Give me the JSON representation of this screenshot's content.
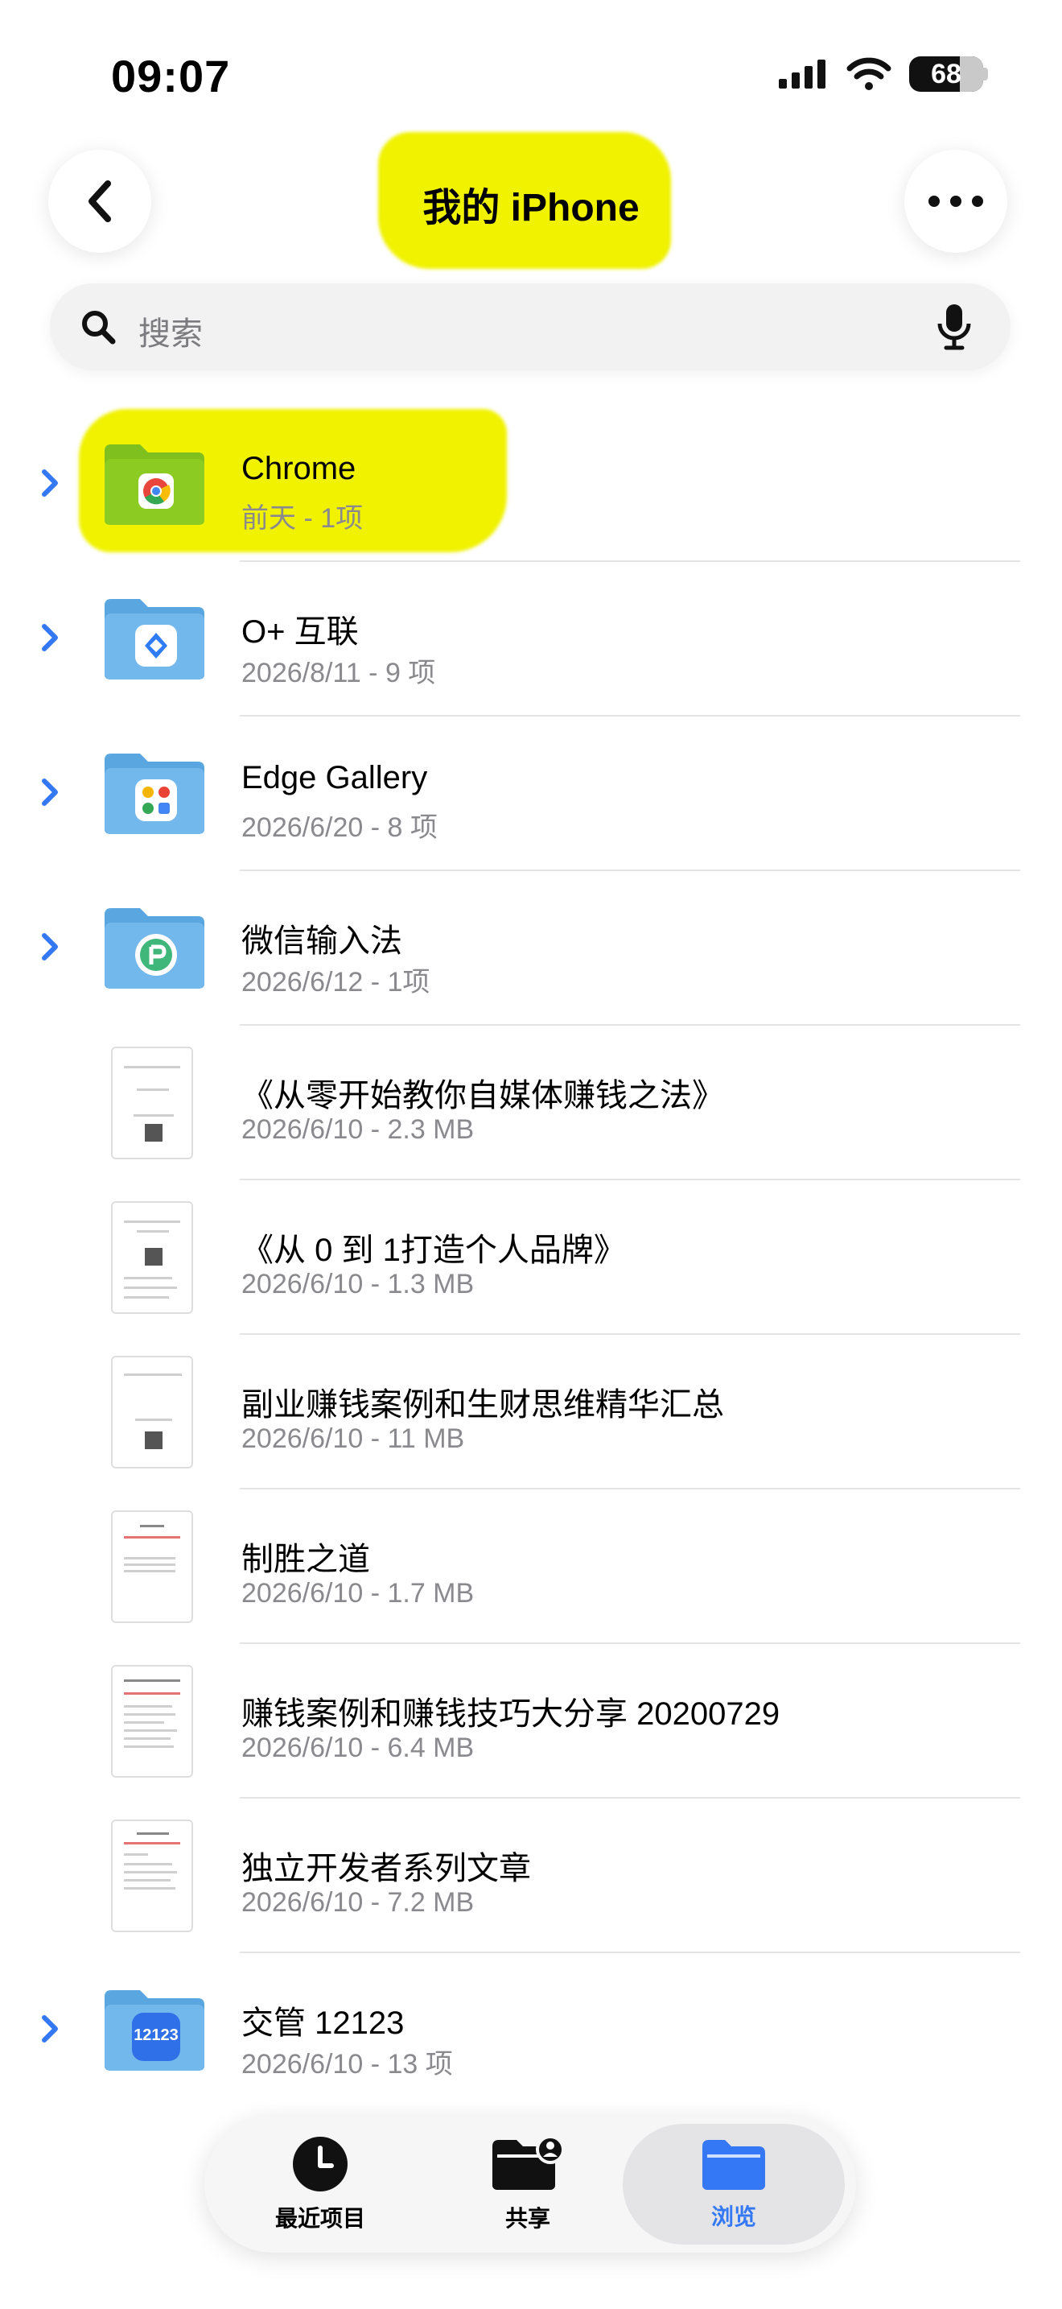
{
  "status": {
    "time": "09:07",
    "battery": "68",
    "battery_fraction": 0.68
  },
  "nav": {
    "title": "我的 iPhone",
    "back_icon": "chevron-left-icon",
    "more_icon": "ellipsis-icon"
  },
  "search": {
    "placeholder": "搜索"
  },
  "items": [
    {
      "name": "Chrome",
      "meta": "前天 - 1项",
      "type": "folder",
      "app": "chrome",
      "highlight": true
    },
    {
      "name": "O+ 互联",
      "meta": "2026/8/11 - 9 项",
      "type": "folder",
      "app": "oplus"
    },
    {
      "name": "Edge Gallery",
      "meta": "2026/6/20 - 8 项",
      "type": "folder",
      "app": "edge-gallery"
    },
    {
      "name": "微信输入法",
      "meta": "2026/6/12 - 1项",
      "type": "folder",
      "app": "wechat-input"
    },
    {
      "name": "《从零开始教你自媒体赚钱之法》",
      "meta": "2026/6/10 - 2.3 MB",
      "type": "document"
    },
    {
      "name": "《从 0 到 1打造个人品牌》",
      "meta": "2026/6/10 - 1.3 MB",
      "type": "document"
    },
    {
      "name": "副业赚钱案例和生财思维精华汇总",
      "meta": "2026/6/10 - 11 MB",
      "type": "document"
    },
    {
      "name": "制胜之道",
      "meta": "2026/6/10 - 1.7 MB",
      "type": "document"
    },
    {
      "name": "赚钱案例和赚钱技巧大分享 20200729",
      "meta": "2026/6/10 - 6.4 MB",
      "type": "document"
    },
    {
      "name": "独立开发者系列文章",
      "meta": "2026/6/10 - 7.2 MB",
      "type": "document"
    },
    {
      "name": "交管 12123",
      "meta": "2026/6/10 - 13 项",
      "type": "folder",
      "app": "jiaoguan-12123"
    }
  ],
  "tabs": [
    {
      "label": "最近项目",
      "icon": "clock-icon",
      "active": false
    },
    {
      "label": "共享",
      "icon": "shared-folder-icon",
      "active": false
    },
    {
      "label": "浏览",
      "icon": "folder-icon",
      "active": true
    }
  ],
  "colors": {
    "accent": "#3478f6",
    "highlight": "#f0f200",
    "folder": "#6db3e8"
  },
  "app_badge_text": {
    "jiaoguan": "12123"
  }
}
